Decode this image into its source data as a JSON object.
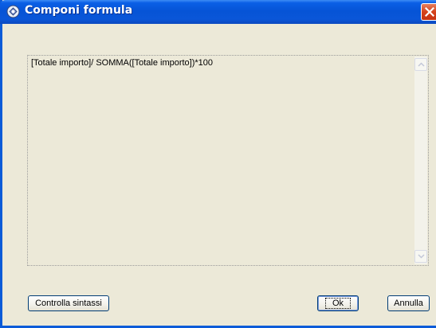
{
  "window": {
    "title": "Componi formula",
    "app_icon": "formula-icon",
    "close_icon": "close-icon"
  },
  "editor": {
    "formula": "[Totale importo]/ SOMMA([Totale importo])*100"
  },
  "buttons": {
    "check_syntax": "Controlla sintassi",
    "ok": "Ok",
    "cancel": "Annulla"
  },
  "colors": {
    "titlebar": "#0654d6",
    "close": "#d5431c",
    "dialog_bg": "#ece9d8"
  }
}
